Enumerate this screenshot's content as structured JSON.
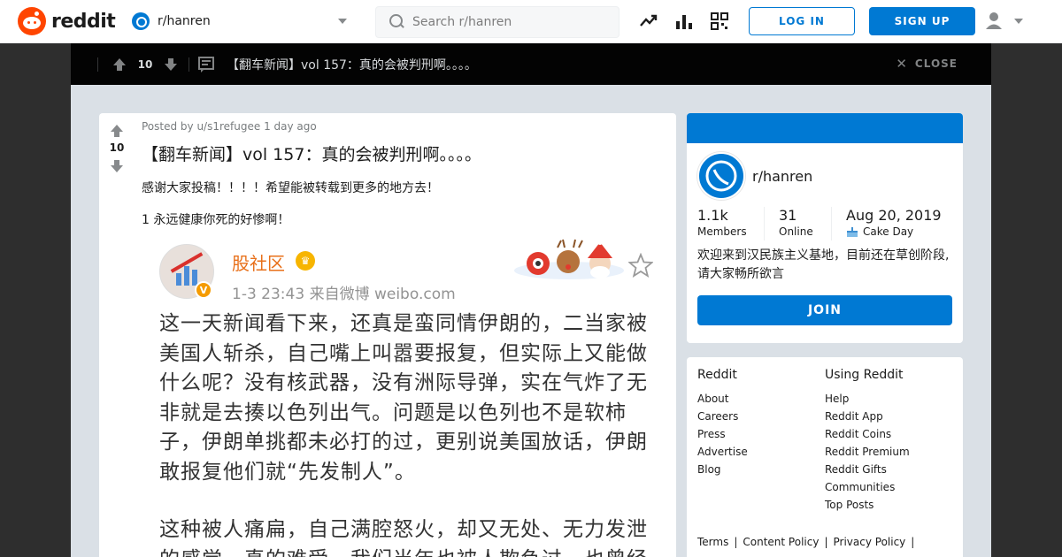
{
  "header": {
    "logo_text": "reddit",
    "subreddit": "r/hanren",
    "search_placeholder": "Search r/hanren",
    "login_label": "LOG IN",
    "signup_label": "SIGN UP"
  },
  "post_bar": {
    "score": "10",
    "title": "【翻车新闻】vol 157：真的会被判刑啊。。。。",
    "close_label": "CLOSE"
  },
  "post": {
    "score": "10",
    "meta": "Posted by u/s1refugee 1 day ago",
    "title": "【翻车新闻】vol 157：真的会被判刑啊。。。。",
    "paragraph1": "感谢大家投稿！！！！希望能被转载到更多的地方去！",
    "paragraph2": "1 永远健康你死的好惨啊！"
  },
  "weibo": {
    "account": "股社区",
    "time_source": "1-3 23:43  来自微博 weibo.com",
    "body": "这一天新闻看下来，还真是蛮同情伊朗的，二当家被美国人斩杀，自己嘴上叫嚣要报复，但实际上又能做什么呢？没有核武器，没有洲际导弹，实在气炸了无非就是去揍以色列出气。问题是以色列也不是软柿子，伊朗单挑都未必打的过，更别说美国放话，伊朗敢报复他们就“先发制人”。",
    "body2": "这种被人痛扁，自己满腔怒火，却又无处、无力发泄的感觉，真的难受。我们当年也被人欺负过，也曾经"
  },
  "community": {
    "name": "r/hanren",
    "members": "1.1k",
    "members_label": "Members",
    "online": "31",
    "online_label": "Online",
    "cake_day": "Aug 20, 2019",
    "cake_day_label": "Cake Day",
    "description": "欢迎来到汉民族主义基地，目前还在草创阶段,请大家畅所欲言",
    "join_label": "JOIN"
  },
  "footer_links": {
    "col1_title": "Reddit",
    "col1": [
      "About",
      "Careers",
      "Press",
      "Advertise",
      "Blog"
    ],
    "col2_title": "Using Reddit",
    "col2": [
      "Help",
      "Reddit App",
      "Reddit Coins",
      "Reddit Premium",
      "Reddit Gifts",
      "Communities",
      "Top Posts"
    ],
    "legal": [
      "Terms",
      "Content Policy",
      "Privacy Policy"
    ]
  },
  "colors": {
    "brand": "#ff4500",
    "accent": "#0079d3",
    "page_bg": "#dae0e6"
  }
}
